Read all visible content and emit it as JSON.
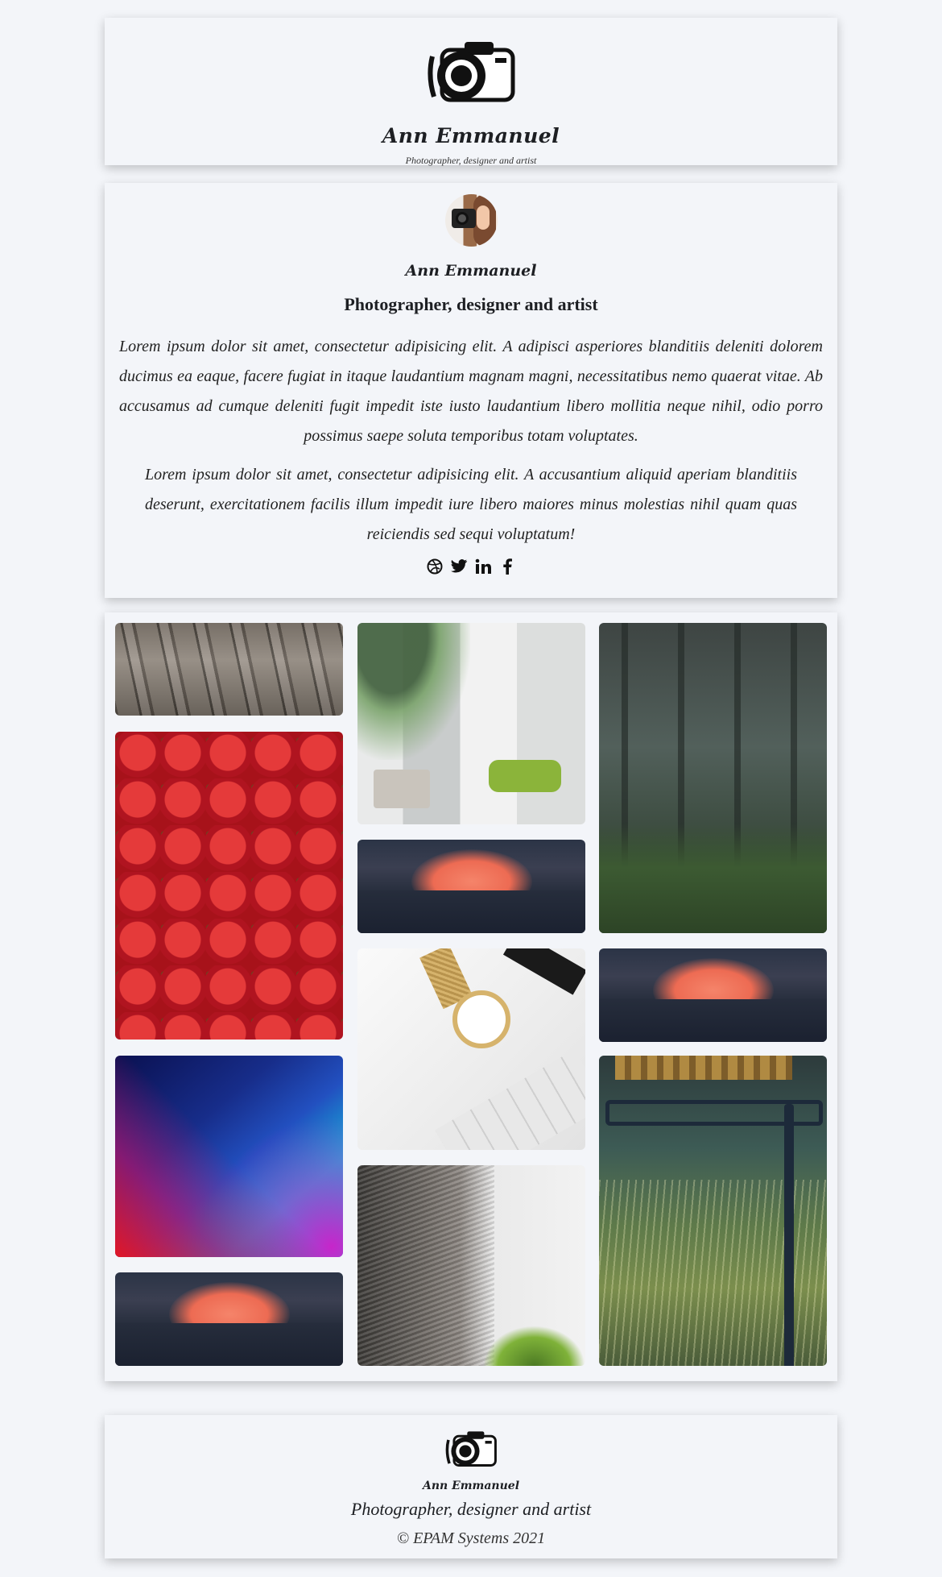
{
  "header": {
    "logo_icon": "camera-icon",
    "brand": "Ann Emmanuel",
    "tagline": "Photographer, designer and artist"
  },
  "about": {
    "avatar_icon": "avatar-photo",
    "name": "Ann Emmanuel",
    "role": "Photographer, designer and artist",
    "paragraphs": [
      "Lorem ipsum dolor sit amet, consectetur adipisicing elit. A adipisci asperiores blanditiis deleniti dolorem ducimus ea eaque, facere fugiat in itaque laudantium magnam magni, necessitatibus nemo quaerat vitae. Ab accusamus ad cumque deleniti fugit impedit iste iusto laudantium libero mollitia neque nihil, odio porro possimus saepe soluta temporibus totam voluptates.",
      "Lorem ipsum dolor sit amet, consectetur adipisicing elit. A accusantium aliquid aperiam blanditiis deserunt, exercitationem facilis illum impedit iure libero maiores minus molestias nihil quam quas reiciendis sed sequi voluptatum!"
    ],
    "social": [
      {
        "icon": "dribbble-icon",
        "glyph": "◍"
      },
      {
        "icon": "twitter-icon",
        "glyph": "🐦"
      },
      {
        "icon": "linkedin-icon",
        "glyph": "in"
      },
      {
        "icon": "facebook-icon",
        "glyph": "f"
      }
    ]
  },
  "gallery": {
    "images": [
      {
        "name": "gallery-image-wooden-deck",
        "subject": "wooden deck"
      },
      {
        "name": "gallery-image-strawberries",
        "subject": "strawberries"
      },
      {
        "name": "gallery-image-neon-gradient",
        "subject": "abstract gradient"
      },
      {
        "name": "gallery-image-sunset-1",
        "subject": "sunset"
      },
      {
        "name": "gallery-image-workspace-plant",
        "subject": "workspace with plant"
      },
      {
        "name": "gallery-image-sunset-2",
        "subject": "sunset"
      },
      {
        "name": "gallery-image-watch-desk",
        "subject": "watch on desk"
      },
      {
        "name": "gallery-image-dog",
        "subject": "dog"
      },
      {
        "name": "gallery-image-forest",
        "subject": "forest"
      },
      {
        "name": "gallery-image-sunset-3",
        "subject": "sunset"
      },
      {
        "name": "gallery-image-chair-grass",
        "subject": "chair in grass"
      }
    ]
  },
  "footer": {
    "logo_icon": "camera-icon",
    "brand": "Ann Emmanuel",
    "tagline": "Photographer, designer and artist",
    "copyright": "© EPAM Systems 2021"
  }
}
